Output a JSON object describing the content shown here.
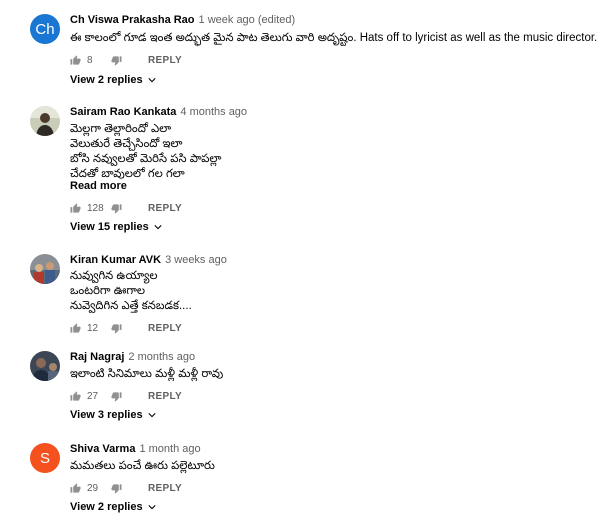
{
  "comments": [
    {
      "author": "Ch Viswa Prakasha Rao",
      "time": "1 week ago (edited)",
      "avatar_letters": "Ch",
      "avatar_color": "#1976d2",
      "lines": [
        "ఈ కాలంలో గూడ ఇంత అద్భుత మైన పాట తెలుగు వారి అదృష్టం. Hats off to lyricist as well as the music director."
      ],
      "read_more": "",
      "likes": "8",
      "reply_label": "REPLY",
      "view_replies": "View 2 replies"
    },
    {
      "author": "Sairam Rao Kankata",
      "time": "4 months ago",
      "avatar_letters": "",
      "lines": [
        "మెల్లగా తెల్లారిందో ఎలా",
        "వెలుతురే తెచ్చేసిందో ఇలా",
        "బోసి నవ్వులతో మెరిసే పసి పాపల్లా",
        "చేదతో బావులలో గల గలా"
      ],
      "read_more": "Read more",
      "likes": "128",
      "reply_label": "REPLY",
      "view_replies": "View 15 replies"
    },
    {
      "author": "Kiran Kumar AVK",
      "time": "3 weeks ago",
      "avatar_letters": "",
      "lines": [
        "నువ్వుగిన ఉయ్యాల",
        "ఒంటరిగా ఊగాల",
        "నువ్వెదిగిన ఎత్తే కనబడక...."
      ],
      "read_more": "",
      "likes": "12",
      "reply_label": "REPLY",
      "view_replies": ""
    },
    {
      "author": "Raj Nagraj",
      "time": "2 months ago",
      "avatar_letters": "",
      "lines": [
        "ఇలాంటి సినిమాలు మళ్లీ మళ్లీ రావు"
      ],
      "read_more": "",
      "likes": "27",
      "reply_label": "REPLY",
      "view_replies": "View 3 replies"
    },
    {
      "author": "Shiva Varma",
      "time": "1 month ago",
      "avatar_letters": "S",
      "avatar_color": "#f4511e",
      "lines": [
        "మమతలు పంచే ఊరు పల్లెటూరు"
      ],
      "read_more": "",
      "likes": "29",
      "reply_label": "REPLY",
      "view_replies": "View 2 replies"
    }
  ]
}
